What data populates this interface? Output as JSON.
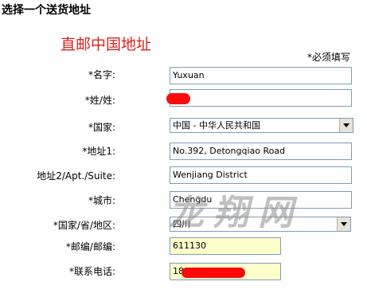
{
  "heading": "选择一个送货地址",
  "form_title": "直邮中国地址",
  "required_note": "*必须填写",
  "fields": {
    "name": {
      "label": "*名字:",
      "value": "Yuxuan"
    },
    "surname": {
      "label": "*姓/姓:",
      "value": ""
    },
    "country": {
      "label": "*国家:",
      "value": "中国 - 中华人民共和国"
    },
    "address1": {
      "label": "*地址1:",
      "value": "No.392, Detongqiao Road"
    },
    "address2": {
      "label": "地址2/Apt./Suite:",
      "value": "Wenjiang District"
    },
    "city": {
      "label": "*城市:",
      "value": "Chengdu"
    },
    "province": {
      "label": "*国家/省/地区:",
      "value": "四川"
    },
    "postcode": {
      "label": "*邮编/邮编:",
      "value": "611130"
    },
    "phone": {
      "label": "*联系电话:",
      "value": "18"
    }
  },
  "watermark": "龙翔网",
  "colors": {
    "title": "#d9231c",
    "redaction": "#ff0a0a",
    "highlight_field": "#ffffcc",
    "field_border": "#7f9db9"
  }
}
